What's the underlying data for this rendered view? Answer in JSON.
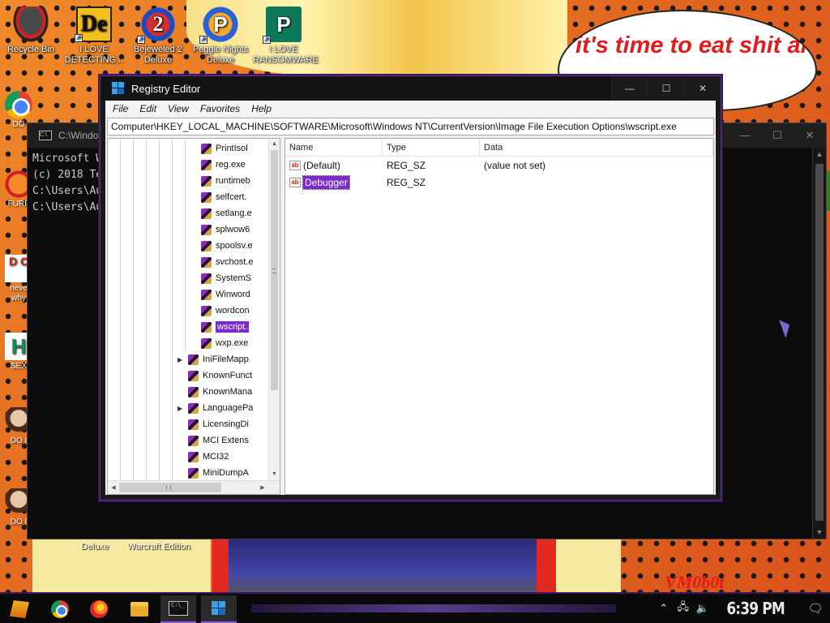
{
  "desktop": {
    "icons": [
      {
        "label": "Recycle Bin",
        "glyph": ""
      },
      {
        "label": "I LOVE DETECTING...",
        "glyph": "De"
      },
      {
        "label": "Bejeweled 2 Deluxe",
        "glyph": "2"
      },
      {
        "label": "Peggle Nights Deluxe",
        "glyph": "P"
      },
      {
        "label": "I LOVE RANSOMWARE",
        "glyph": "P"
      }
    ],
    "left_icons": [
      {
        "label": "DO",
        "glyph": ""
      },
      {
        "label": "FURF",
        "glyph": ""
      },
      {
        "label": "neve why",
        "glyph": "D C"
      },
      {
        "label": "SEX",
        "glyph": "H"
      },
      {
        "label": "DO I",
        "glyph": ""
      },
      {
        "label": "DO I",
        "glyph": ""
      }
    ],
    "bubble_text": "it's time to eat shit and die and chew",
    "bottom_labels": [
      "Deluxe",
      "Warcraft Edition"
    ],
    "bottom_art_text": "VM0b0t"
  },
  "cmd": {
    "title": "C:\\Windo",
    "lines": [
      "Microsoft W",
      "(c) 2018 Te",
      "",
      "C:\\Users\\Au",
      "",
      "C:\\Users\\Au"
    ]
  },
  "regedit": {
    "title": "Registry Editor",
    "menu": [
      "File",
      "Edit",
      "View",
      "Favorites",
      "Help"
    ],
    "address": "Computer\\HKEY_LOCAL_MACHINE\\SOFTWARE\\Microsoft\\Windows NT\\CurrentVersion\\Image File Execution Options\\wscript.exe",
    "tree_items": [
      {
        "label": "PrintIsol",
        "depth": 2,
        "selected": false,
        "expander": ""
      },
      {
        "label": "reg.exe",
        "depth": 2,
        "selected": false,
        "expander": ""
      },
      {
        "label": "runtimeb",
        "depth": 2,
        "selected": false,
        "expander": ""
      },
      {
        "label": "selfcert.",
        "depth": 2,
        "selected": false,
        "expander": ""
      },
      {
        "label": "setlang.e",
        "depth": 2,
        "selected": false,
        "expander": ""
      },
      {
        "label": "splwow6",
        "depth": 2,
        "selected": false,
        "expander": ""
      },
      {
        "label": "spoolsv.e",
        "depth": 2,
        "selected": false,
        "expander": ""
      },
      {
        "label": "svchost.e",
        "depth": 2,
        "selected": false,
        "expander": ""
      },
      {
        "label": "SystemS",
        "depth": 2,
        "selected": false,
        "expander": ""
      },
      {
        "label": "Winword",
        "depth": 2,
        "selected": false,
        "expander": ""
      },
      {
        "label": "wordcon",
        "depth": 2,
        "selected": false,
        "expander": ""
      },
      {
        "label": "wscript.",
        "depth": 2,
        "selected": true,
        "expander": ""
      },
      {
        "label": "wxp.exe",
        "depth": 2,
        "selected": false,
        "expander": ""
      },
      {
        "label": "IniFileMapp",
        "depth": 1,
        "selected": false,
        "expander": "▶"
      },
      {
        "label": "KnownFunct",
        "depth": 1,
        "selected": false,
        "expander": ""
      },
      {
        "label": "KnownMana",
        "depth": 1,
        "selected": false,
        "expander": ""
      },
      {
        "label": "LanguagePa",
        "depth": 1,
        "selected": false,
        "expander": "▶"
      },
      {
        "label": "LicensingDi",
        "depth": 1,
        "selected": false,
        "expander": ""
      },
      {
        "label": "MCI Extens",
        "depth": 1,
        "selected": false,
        "expander": ""
      },
      {
        "label": "MCI32",
        "depth": 1,
        "selected": false,
        "expander": ""
      },
      {
        "label": "MiniDumpA",
        "depth": 1,
        "selected": false,
        "expander": ""
      }
    ],
    "columns": [
      "Name",
      "Type",
      "Data"
    ],
    "values": [
      {
        "name": "(Default)",
        "type": "REG_SZ",
        "data": "(value not set)",
        "selected": false
      },
      {
        "name": "Debugger",
        "type": "REG_SZ",
        "data": "",
        "selected": true
      }
    ]
  },
  "taskbar": {
    "clock": "6:39 PM",
    "cmd_glyph": "C:\\_"
  }
}
